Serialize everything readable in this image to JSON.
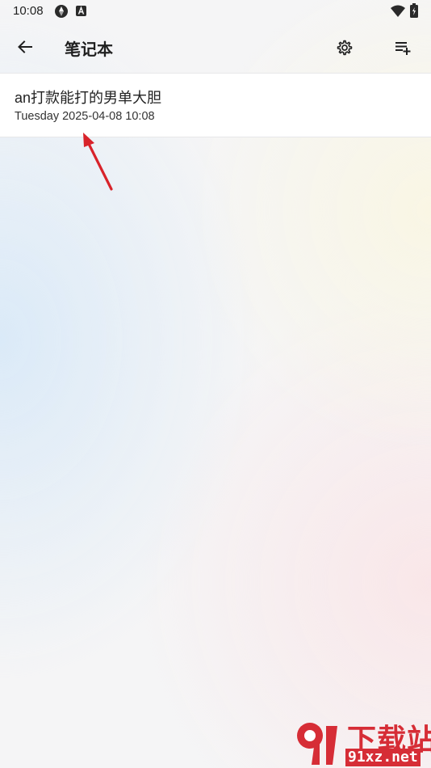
{
  "status_bar": {
    "time": "10:08",
    "icons": [
      "sync-icon",
      "a-badge-icon",
      "wifi-icon",
      "battery-icon"
    ]
  },
  "app_bar": {
    "title": "笔记本",
    "back_icon": "arrow-left-icon",
    "settings_icon": "gear-icon",
    "add_icon": "playlist-add-icon"
  },
  "notes": [
    {
      "title": "an打款能打的男单大胆",
      "date": "Tuesday 2025-04-08 10:08"
    }
  ],
  "watermark": {
    "brand": "下载站",
    "domain": "91xz.net"
  },
  "colors": {
    "annotation": "#d8232a",
    "watermark": "#d62d36"
  }
}
